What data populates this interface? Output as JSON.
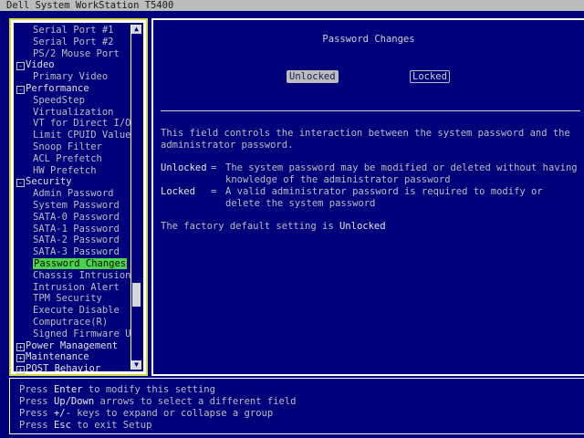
{
  "window": {
    "title": "Dell System WorkStation T5400"
  },
  "tree": {
    "items": [
      {
        "type": "child",
        "label": "Serial Port #1"
      },
      {
        "type": "child",
        "label": "Serial Port #2"
      },
      {
        "type": "child",
        "label": "PS/2 Mouse Port"
      },
      {
        "type": "group",
        "label": "Video",
        "expander": "-"
      },
      {
        "type": "child",
        "label": "Primary Video"
      },
      {
        "type": "group",
        "label": "Performance",
        "expander": "-"
      },
      {
        "type": "child",
        "label": "SpeedStep"
      },
      {
        "type": "child",
        "label": "Virtualization"
      },
      {
        "type": "child",
        "label": "VT for Direct I/O"
      },
      {
        "type": "child",
        "label": "Limit CPUID Value"
      },
      {
        "type": "child",
        "label": "Snoop Filter"
      },
      {
        "type": "child",
        "label": "ACL Prefetch"
      },
      {
        "type": "child",
        "label": "HW Prefetch"
      },
      {
        "type": "group",
        "label": "Security",
        "expander": "-"
      },
      {
        "type": "child",
        "label": "Admin Password"
      },
      {
        "type": "child",
        "label": "System Password"
      },
      {
        "type": "child",
        "label": "SATA-0 Password"
      },
      {
        "type": "child",
        "label": "SATA-1 Password"
      },
      {
        "type": "child",
        "label": "SATA-2 Password"
      },
      {
        "type": "child",
        "label": "SATA-3 Password"
      },
      {
        "type": "child",
        "label": "Password Changes",
        "selected": true
      },
      {
        "type": "child",
        "label": "Chassis Intrusion"
      },
      {
        "type": "child",
        "label": "Intrusion Alert"
      },
      {
        "type": "child",
        "label": "TPM Security"
      },
      {
        "type": "child",
        "label": "Execute Disable"
      },
      {
        "type": "child",
        "label": "Computrace(R)"
      },
      {
        "type": "child",
        "label": "Signed Firmware U"
      },
      {
        "type": "group",
        "label": "Power Management",
        "expander": "+"
      },
      {
        "type": "group",
        "label": "Maintenance",
        "expander": "+"
      },
      {
        "type": "group",
        "label": "POST Behavior",
        "expander": "+"
      }
    ],
    "scroll_up_icon": "▲",
    "scroll_down_icon": "▼"
  },
  "setting": {
    "title": "Password Changes",
    "options": [
      {
        "label": "Unlocked",
        "selected": true
      },
      {
        "label": "Locked",
        "selected": false
      }
    ],
    "description": "This field controls the interaction between the system password and the administrator password.",
    "definitions": [
      {
        "term": "Unlocked",
        "eq": "=",
        "text": "The system password may be modified or deleted without having knowledge of the administrator password"
      },
      {
        "term": "Locked",
        "eq": "=",
        "text": "A valid administrator password is required to modify or delete the system password"
      }
    ],
    "factory_prefix": "The factory default setting is",
    "factory_value": "Unlocked"
  },
  "help": {
    "lines": [
      {
        "pre": "Press",
        "key": "Enter",
        "post": "to modify this setting"
      },
      {
        "pre": "Press",
        "key": "Up/Down",
        "post": "arrows to select a different field"
      },
      {
        "pre": "Press",
        "key": "+/-",
        "post": "keys to expand or collapse a group"
      },
      {
        "pre": "Press",
        "key": "Esc",
        "post": "to exit Setup"
      }
    ]
  },
  "colors": {
    "background": "#00007a",
    "selected_highlight": "#4bd44b",
    "panel_border_focus": "#d6d64a"
  }
}
